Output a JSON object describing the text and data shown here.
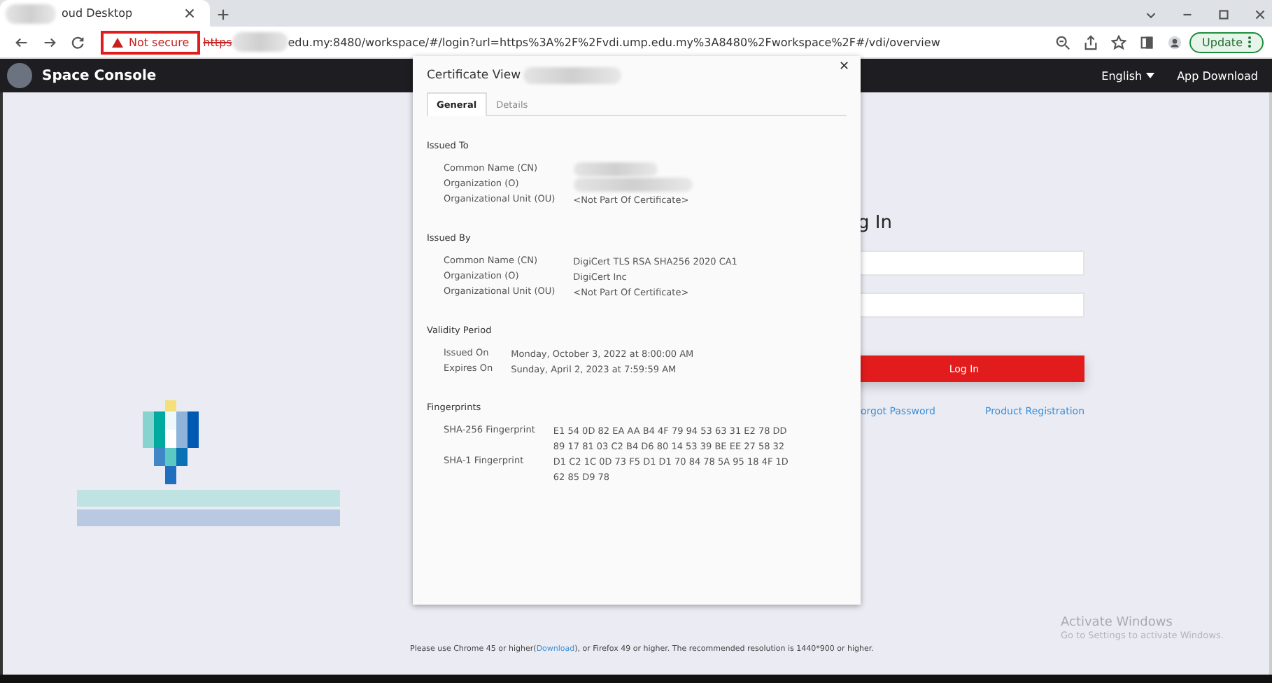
{
  "browser": {
    "tab": {
      "title": "oud Desktop",
      "selected": true
    },
    "security_chip": "Not secure",
    "url_scheme": "https",
    "url_rest": "edu.my:8480/workspace/#/login?url=https%3A%2F%2Fvdi.ump.edu.my%3A8480%2Fworkspace%2F#/vdi/overview",
    "update_button": "Update"
  },
  "header": {
    "title": "Space Console",
    "language": "English",
    "app_download": "App Download"
  },
  "login": {
    "title": "g In",
    "button": "Log In",
    "links": [
      "orgot Password",
      "Product Registration"
    ]
  },
  "dialog": {
    "title": "Certificate View",
    "close": "✕",
    "tabs": [
      {
        "label": "General",
        "selected": true
      },
      {
        "label": "Details",
        "selected": false
      }
    ],
    "sections": [
      {
        "title": "Issued To",
        "rows": [
          {
            "kind": "redacted",
            "label": "Common Name (CN)"
          },
          {
            "kind": "redacted",
            "label": "Organization (O)"
          },
          {
            "kind": "text",
            "label": "Organizational Unit (OU)",
            "lines": [
              "<Not Part Of Certificate>"
            ]
          }
        ]
      },
      {
        "title": "Issued By",
        "rows": [
          {
            "kind": "text",
            "label": "Common Name (CN)",
            "lines": [
              "DigiCert TLS RSA SHA256 2020 CA1"
            ]
          },
          {
            "kind": "text",
            "label": "Organization (O)",
            "lines": [
              "DigiCert Inc"
            ]
          },
          {
            "kind": "text",
            "label": "Organizational Unit (OU)",
            "lines": [
              "<Not Part Of Certificate>"
            ]
          }
        ]
      },
      {
        "title": "Validity Period",
        "rows": [
          {
            "kind": "text",
            "label": "Issued On",
            "lines": [
              "Monday, October 3, 2022 at 8:00:00 AM"
            ]
          },
          {
            "kind": "text",
            "label": "Expires On",
            "lines": [
              "Sunday, April 2, 2023 at 7:59:59 AM"
            ]
          }
        ]
      },
      {
        "title": "Fingerprints",
        "rows": [
          {
            "kind": "text",
            "label": "SHA-256 Fingerprint",
            "lines": [
              "E1 54 0D 82 EA AA B4 4F 79 94 53 63 31 E2 78 DD",
              "89 17 81 03 C2 B4 D6 80 14 53 39 BE EE 27 58 32"
            ]
          },
          {
            "kind": "text",
            "label": "SHA-1 Fingerprint",
            "lines": [
              "D1 C2 1C 0D 73 F5 D1 D1 70 84 78 5A 95 18 4F 1D",
              "62 85 D9 78"
            ]
          }
        ]
      }
    ]
  },
  "footer": {
    "before": "Please use Chrome 45 or higher(",
    "link": "Download",
    "after": "), or Firefox 49 or higher. The recommended resolution is 1440*900 or higher."
  },
  "os_notice": {
    "title": "Activate Windows",
    "subtitle": "Go to Settings to activate Windows."
  }
}
